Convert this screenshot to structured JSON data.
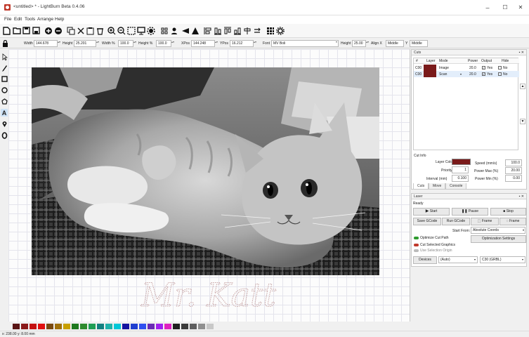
{
  "window": {
    "title": "<untitled> * - LightBurn Beta 0.4.06",
    "minimize_glyph": "–",
    "maximize_glyph": "☐",
    "close_glyph": "✕"
  },
  "menu": [
    "File",
    "Edit",
    "Tools",
    "Arrange",
    "Help"
  ],
  "toolbar_icons": [
    "new-file-icon",
    "open-folder-icon",
    "save-icon",
    "save-as-icon",
    "import-icon",
    "export-icon",
    "cut-icon",
    "copy-icon",
    "paste-icon",
    "delete-icon",
    "zoom-in-icon",
    "zoom-out-icon",
    "zoom-frame-icon",
    "frame-icon",
    "settings-icon",
    "group-icon",
    "user-icon",
    "mirror-icon",
    "align-icon",
    "distribute-left-icon",
    "distribute-center-icon",
    "distribute-top-icon",
    "distribute-right-icon",
    "distribute-bottom-icon",
    "flip-icon",
    "grid-icon",
    "gear-icon"
  ],
  "props": {
    "width_label": "Width",
    "width_value": "144.678",
    "height_label": "Height",
    "height_value": "25.201",
    "width_pct_label": "Width %",
    "width_pct_value": "100.0",
    "height_pct_label": "Height %",
    "height_pct_value": "100.0",
    "xpos_label": "XPos",
    "xpos_value": "144.248",
    "ypos_label": "YPos",
    "ypos_value": "16.212",
    "font_label": "Font",
    "font_value": "MV Boli",
    "text_height_label": "Height",
    "text_height_value": "25.00",
    "align_x_label": "Align X",
    "align_x_value": "Middle",
    "align_y_label": "Y",
    "align_y_value": "Middle"
  },
  "left_tools": [
    "select-arrow-icon",
    "draw-pen-icon",
    "rectangle-icon",
    "ellipse-icon",
    "polygon-icon",
    "text-tool-icon",
    "position-pin-icon",
    "measure-tool-icon"
  ],
  "cuts_panel": {
    "title": "Cuts",
    "columns": [
      "#",
      "Layer",
      "Mode",
      "Power",
      "Output",
      "Hide"
    ],
    "rows": [
      {
        "num": "C00",
        "color": "#7a1a1a",
        "mode": "Image",
        "power": "20.0",
        "output": "Yes",
        "hide": "No"
      },
      {
        "num": "C00",
        "color": "#7a1a1a",
        "mode": "Scan",
        "power": "20.0",
        "output": "Yes",
        "hide": "No"
      }
    ],
    "cut_info_label": "Cut Info",
    "layer_color_label": "Layer Color",
    "layer_color": "#7a1a1a",
    "priority_label": "Priority",
    "priority_value": "1",
    "interval_label": "Interval (mm)",
    "interval_value": "0.100",
    "speed_label": "Speed (mm/s)",
    "speed_value": "100.0",
    "power_max_label": "Power Max (%)",
    "power_max_value": "20.00",
    "power_min_label": "Power Min (%)",
    "power_min_value": "0.00",
    "tabs": [
      "Cuts",
      "Move",
      "Console"
    ]
  },
  "laser_panel": {
    "title": "Laser",
    "status": "Ready",
    "start_label": "Start",
    "pause_label": "Pause",
    "stop_label": "Stop",
    "save_gcode_label": "Save GCode",
    "run_gcode_label": "Run GCode",
    "frame1_label": "Frame",
    "frame2_label": "Frame",
    "start_from_label": "Start From:",
    "start_from_value": "Absolute Coords",
    "optimize_label": "Optimize Cut Path",
    "cut_selected_label": "Cut Selected Graphics",
    "use_origin_label": "Use Selection Origin",
    "optimization_settings_label": "Optimization Settings",
    "devices_label": "Devices",
    "device_port": "(Auto)",
    "device_name": "C30 (GRBL)"
  },
  "canvas": {
    "signature_text": "Mr. Katt"
  },
  "palette": [
    "#5a1515",
    "#8b1a1a",
    "#c41010",
    "#e01010",
    "#7a4a10",
    "#a0700a",
    "#c8a000",
    "#1e7a1e",
    "#2e8b2e",
    "#1f9e55",
    "#138080",
    "#20b2aa",
    "#00c8d8",
    "#1515a0",
    "#1f3fd0",
    "#3050f0",
    "#6a2ab5",
    "#a020f0",
    "#e020c0",
    "#202020",
    "#3c3c3c",
    "#606060",
    "#909090",
    "#c8c8c8"
  ],
  "status": {
    "coords": "x: 238.00  y: 8.00 mm"
  }
}
